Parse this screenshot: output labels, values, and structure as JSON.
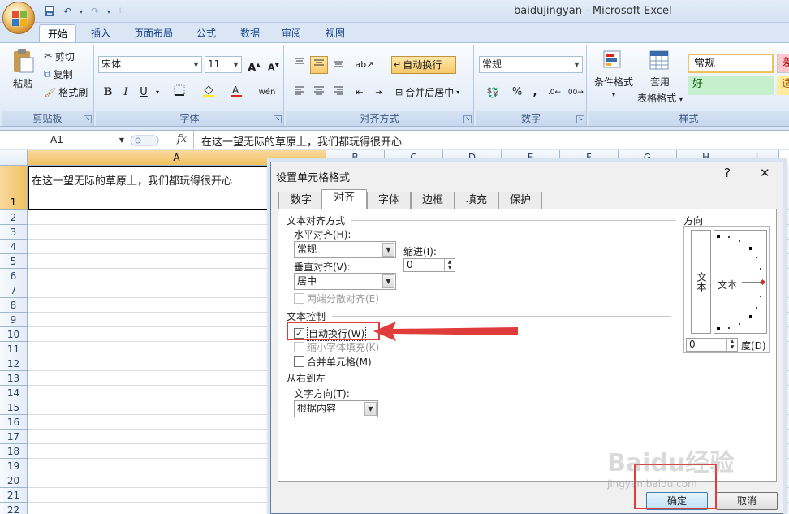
{
  "window": {
    "title": "baidujingyan - Microsoft Excel"
  },
  "quick_access": {
    "icons": [
      "save-icon",
      "undo-icon",
      "redo-icon",
      "customize-icon"
    ]
  },
  "ribbon_tabs": [
    "开始",
    "插入",
    "页面布局",
    "公式",
    "数据",
    "审阅",
    "视图"
  ],
  "clipboard": {
    "paste": "粘贴",
    "cut": "剪切",
    "copy": "复制",
    "format_painter": "格式刷",
    "label": "剪贴板"
  },
  "font": {
    "name": "宋体",
    "size": "11",
    "label": "字体",
    "bold": "B",
    "italic": "I",
    "underline": "U",
    "grow": "A",
    "shrink": "A",
    "wen": "wén"
  },
  "alignment": {
    "wrap_text": "自动换行",
    "merge_center": "合并后居中",
    "label": "对齐方式"
  },
  "number": {
    "format": "常规",
    "label": "数字",
    "percent": "%",
    "comma": ","
  },
  "styles": {
    "conditional": "条件格式",
    "table_format_1": "套用",
    "table_format_2": "表格格式",
    "normal": "常规",
    "good": "好",
    "bad": "差",
    "neutral": "适",
    "label": "样式"
  },
  "formula_bar": {
    "name_box": "A1",
    "fx": "fx",
    "content": "在这一望无际的草原上，我们都玩得很开心"
  },
  "sheet": {
    "columns": [
      "A",
      "B",
      "C",
      "D",
      "E",
      "F",
      "G",
      "H",
      "I"
    ],
    "rows": [
      "1",
      "2",
      "3",
      "4",
      "5",
      "6",
      "7",
      "8",
      "9",
      "10",
      "11",
      "12",
      "13",
      "14",
      "15",
      "16",
      "17",
      "18",
      "19",
      "20",
      "21",
      "22"
    ],
    "a1": "在这一望无际的草原上，我们都玩得很开心"
  },
  "dialog": {
    "title": "设置单元格格式",
    "help": "?",
    "close": "✕",
    "tabs": [
      "数字",
      "对齐",
      "字体",
      "边框",
      "填充",
      "保护"
    ],
    "active_tab": "对齐",
    "text_alignment_header": "文本对齐方式",
    "horizontal_label": "水平对齐(H):",
    "horizontal_value": "常规",
    "indent_label": "缩进(I):",
    "indent_value": "0",
    "vertical_label": "垂直对齐(V):",
    "vertical_value": "居中",
    "distributed": "两端分散对齐(E)",
    "text_control_header": "文本控制",
    "wrap_text": "自动换行(W)",
    "wrap_text_checked": true,
    "shrink_to_fit": "缩小字体填充(K)",
    "merge_cells": "合并单元格(M)",
    "rtl_header": "从右到左",
    "text_direction_label": "文字方向(T):",
    "text_direction_value": "根据内容",
    "orientation_header": "方向",
    "orientation_vertical_text": "文本",
    "orientation_text": "文本",
    "degree_value": "0",
    "degree_label": "度(D)",
    "ok": "确定",
    "cancel": "取消"
  },
  "watermark": {
    "text": "Baidu经验",
    "sub": "jingyan.baidu.com"
  },
  "colors": {
    "annotation": "#e03c3c",
    "selection_header": "#f1c15f",
    "ribbon": "#dbe7f5"
  }
}
